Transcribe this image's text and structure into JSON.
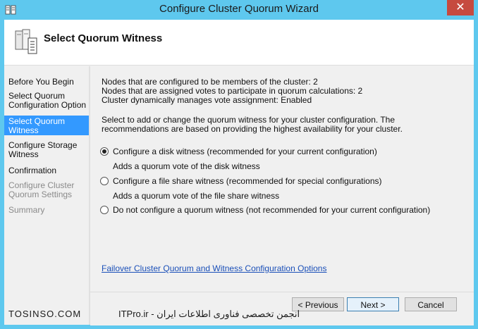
{
  "window": {
    "title": "Configure Cluster Quorum Wizard",
    "close_glyph": "✕"
  },
  "header": {
    "title": "Select Quorum Witness"
  },
  "nav": {
    "items": [
      {
        "label": "Before You Begin",
        "state": "normal"
      },
      {
        "label": "Select Quorum Configuration Option",
        "state": "normal"
      },
      {
        "label": "Select Quorum Witness",
        "state": "selected"
      },
      {
        "label": "Configure Storage Witness",
        "state": "normal"
      },
      {
        "label": "Confirmation",
        "state": "normal"
      },
      {
        "label": "Configure Cluster Quorum Settings",
        "state": "disabled"
      },
      {
        "label": "Summary",
        "state": "disabled"
      }
    ]
  },
  "info": {
    "line1": "Nodes that are configured to be members of the cluster: 2",
    "line2": "Nodes that are assigned votes to participate in quorum calculations: 2",
    "line3": "Cluster dynamically manages vote assignment: Enabled"
  },
  "description": "Select to add or change the quorum witness for your cluster configuration. The recommendations are based on providing the highest availability for your cluster.",
  "options": [
    {
      "label": "Configure a disk witness  (recommended for your current configuration)",
      "sub": "Adds a quorum vote of the disk witness",
      "checked": true
    },
    {
      "label": "Configure a file share witness (recommended for special configurations)",
      "sub": "Adds a quorum vote of the file share witness",
      "checked": false
    },
    {
      "label": "Do not configure a quorum witness (not recommended for your current configuration)",
      "sub": "",
      "checked": false
    }
  ],
  "link": {
    "label": "Failover Cluster Quorum and Witness Configuration Options"
  },
  "buttons": {
    "previous": "< Previous",
    "next": "Next >",
    "cancel": "Cancel"
  },
  "watermark": {
    "left": "TOSINSO.COM",
    "right": "انجمن تخصصی فناوری اطلاعات ایران - ITPro.ir"
  },
  "colors": {
    "title_bar": "#5ec8ee",
    "selected_nav": "#3399ff",
    "close_button": "#c64a3f",
    "link": "#1a4fb8"
  }
}
